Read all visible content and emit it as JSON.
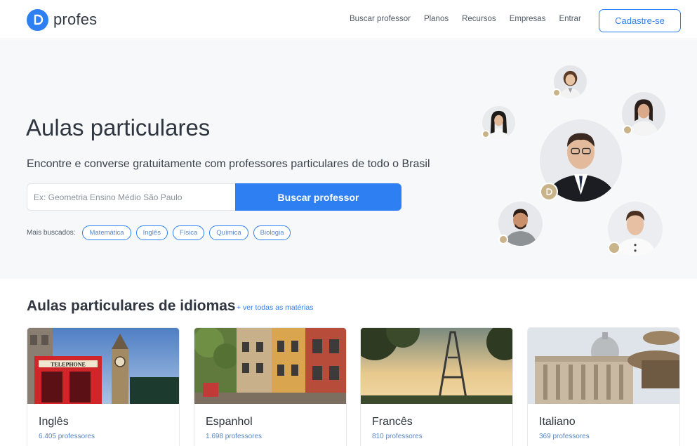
{
  "header": {
    "logo_text": "profes",
    "nav": [
      "Buscar professor",
      "Planos",
      "Recursos",
      "Empresas",
      "Entrar"
    ],
    "signup": "Cadastre-se"
  },
  "hero": {
    "title": "Aulas particulares",
    "subtitle": "Encontre e converse gratuitamente com professores particulares de todo o Brasil",
    "search_placeholder": "Ex: Geometria Ensino Médio São Paulo",
    "search_button": "Buscar professor",
    "popular_label": "Mais buscados:",
    "popular_tags": [
      "Matemática",
      "Inglês",
      "Física",
      "Química",
      "Biologia"
    ]
  },
  "languages": {
    "title": "Aulas particulares de idiomas",
    "see_all": "+ ver todas as matérias",
    "cards": [
      {
        "name": "Inglês",
        "count": "6.405 professores"
      },
      {
        "name": "Espanhol",
        "count": "1.698 professores"
      },
      {
        "name": "Francês",
        "count": "810 professores"
      },
      {
        "name": "Italiano",
        "count": "369 professores"
      }
    ]
  },
  "colors": {
    "brand": "#2d7ff2",
    "badge": "#c9b48a"
  },
  "icons": [
    "profes-logo-icon",
    "teacher-badge-icon"
  ]
}
